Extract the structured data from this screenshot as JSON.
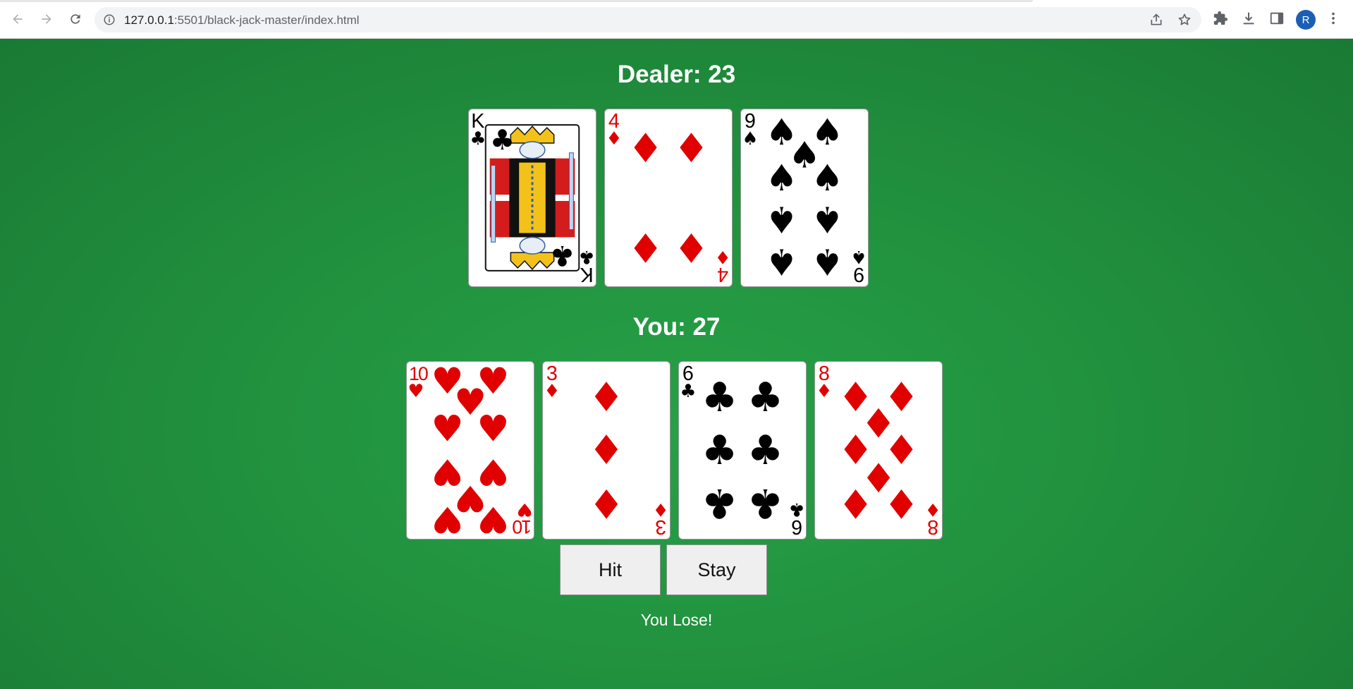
{
  "browser": {
    "url_host": "127.0.0.1",
    "url_path": ":5501/black-jack-master/index.html",
    "avatar_letter": "R"
  },
  "game": {
    "dealer_label": "Dealer: 23",
    "player_label": "You: 27",
    "hit_label": "Hit",
    "stay_label": "Stay",
    "result_text": "You Lose!",
    "dealer_cards": [
      {
        "rank": "K",
        "suit": "clubs"
      },
      {
        "rank": "4",
        "suit": "diamonds"
      },
      {
        "rank": "9",
        "suit": "spades"
      }
    ],
    "player_cards": [
      {
        "rank": "10",
        "suit": "hearts"
      },
      {
        "rank": "3",
        "suit": "diamonds"
      },
      {
        "rank": "6",
        "suit": "clubs"
      },
      {
        "rank": "8",
        "suit": "diamonds"
      }
    ]
  },
  "colors": {
    "felt": "#1f8a3a",
    "red_suit": "#e00000",
    "black_suit": "#000000"
  }
}
